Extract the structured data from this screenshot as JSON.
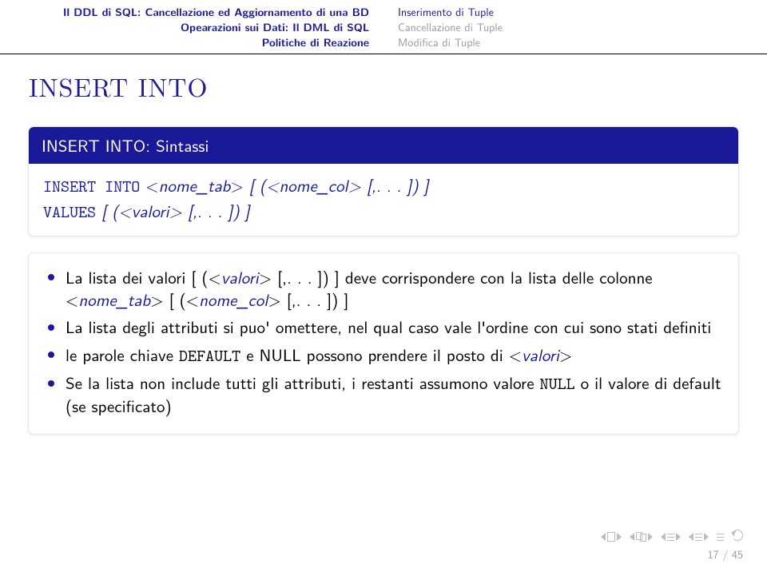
{
  "header": {
    "left": [
      "Il DDL di SQL: Cancellazione ed Aggiornamento di una BD",
      "Opearazioni sui Dati: Il DML di SQL",
      "Politiche di Reazione"
    ],
    "right": [
      {
        "text": "Inserimento di Tuple",
        "active": true
      },
      {
        "text": "Cancellazione di Tuple",
        "active": false
      },
      {
        "text": "Modifica di Tuple",
        "active": false
      }
    ]
  },
  "title": "INSERT INTO",
  "syntax_block": {
    "title": "INSERT INTO: Sintassi",
    "lines": {
      "insert_kw": "INSERT INTO",
      "l1_open": " <",
      "nome_tab": "nome_tab",
      "l1_gt": ">",
      "l1_sp1": " [ (<",
      "nome_col": "nome_col",
      "l1_tail": "> [,. . . ]) ]",
      "values_kw": "VALUES",
      "l2_sp1": " [ (<",
      "valori": "valori",
      "l2_tail": "> [,. . . ]) ]"
    }
  },
  "bullets": {
    "b1_a": "La lista dei valori [ (<",
    "b1_val": "valori",
    "b1_b": "> [,. . . ]) ] deve corrispondere con la lista delle colonne <",
    "b1_nt": "nome_tab",
    "b1_c": "> [ (<",
    "b1_nc": "nome_col",
    "b1_d": "> [,. . . ]) ]",
    "b2": "La lista degli attributi si puo' omettere, nel qual caso vale l'ordine con cui sono stati definiti",
    "b3_a": "le parole chiave ",
    "b3_def": "DEFAULT",
    "b3_b": " e NULL possono prendere il posto di <",
    "b3_val": "valori",
    "b3_c": ">",
    "b4_a": "Se la lista non include tutti gli attributi, i restanti assumono valore ",
    "b4_null": "NULL",
    "b4_b": " o il valore di default (se specificato)"
  },
  "page": {
    "current": "17",
    "total": "45"
  }
}
